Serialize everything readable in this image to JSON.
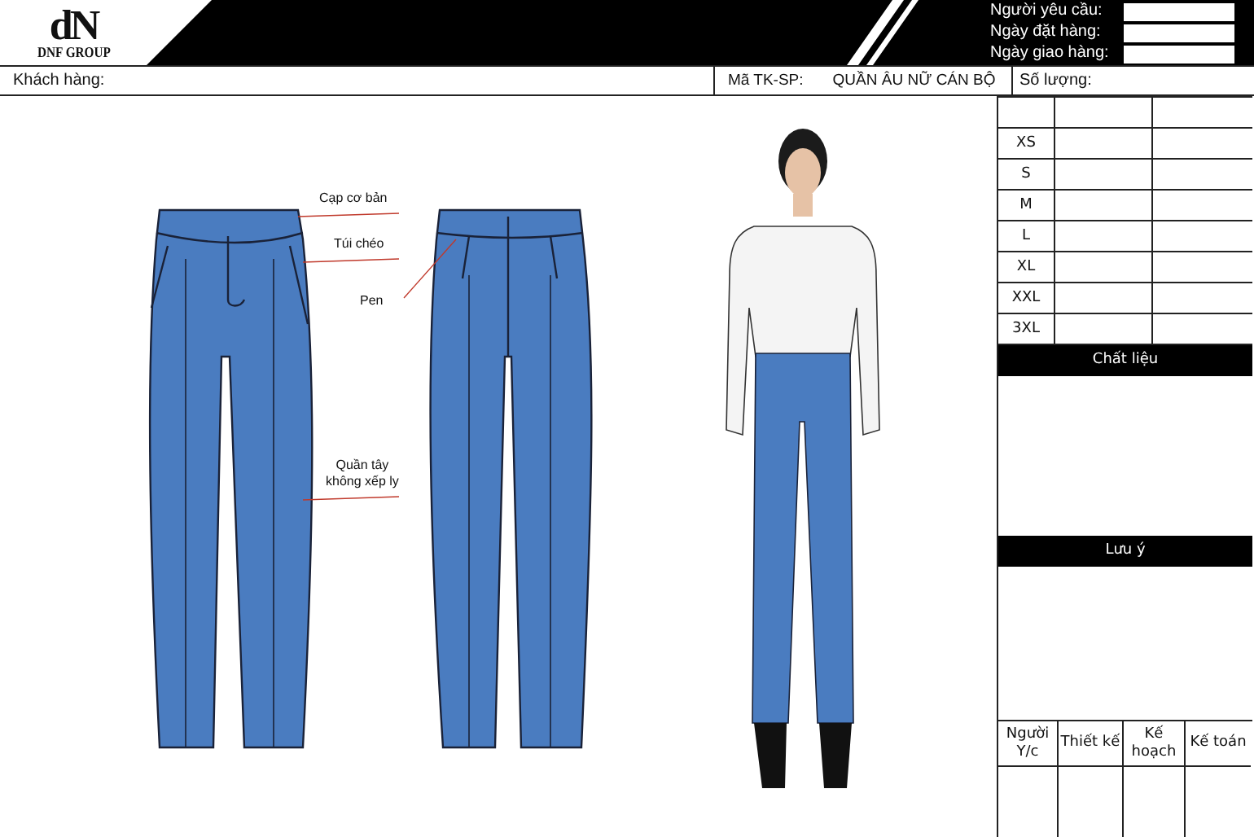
{
  "header": {
    "logo_mark": "dN",
    "logo_text": "DNF GROUP",
    "fields": [
      {
        "label": "Người yêu cầu:"
      },
      {
        "label": "Ngày đặt hàng:"
      },
      {
        "label": "Ngày giao hàng:"
      }
    ]
  },
  "info_bar": {
    "customer_label": "Khách hàng:",
    "product_code_label": "Mã TK-SP:",
    "product_code_value": "QUẦN ÂU NỮ CÁN BỘ",
    "quantity_label": "Số lượng:"
  },
  "callouts": [
    {
      "text": "Cạp cơ bản"
    },
    {
      "text": "Túi chéo"
    },
    {
      "text": "Pen"
    },
    {
      "text": "Quần tây\nkhông xếp ly"
    }
  ],
  "size_table": {
    "sizes": [
      "XS",
      "S",
      "M",
      "L",
      "XL",
      "XXL",
      "3XL"
    ]
  },
  "material": {
    "title": "Chất liệu"
  },
  "notes": {
    "title": "Lưu ý"
  },
  "approvals": [
    "Người\nY/c",
    "Thiết kế",
    "Kế\nhoạch",
    "Kế toán"
  ]
}
